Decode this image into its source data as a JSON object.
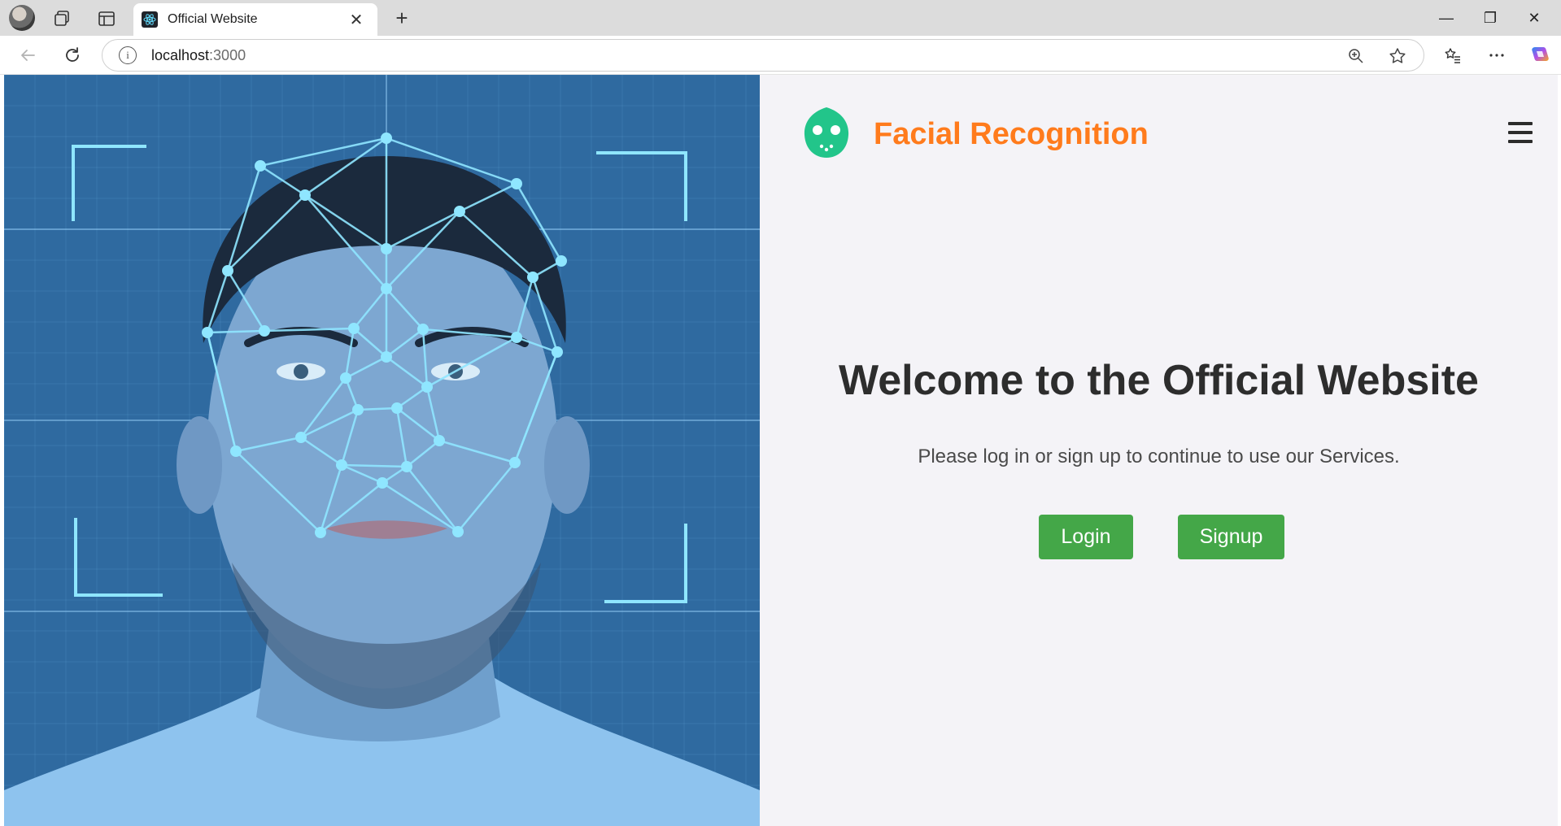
{
  "browser": {
    "tab_title": "Official Website",
    "tab_close": "✕",
    "new_tab": "+",
    "url_host": "localhost",
    "url_port": ":3000",
    "info_glyph": "i",
    "window_controls": {
      "minimize": "—",
      "restore": "❐",
      "close": "✕"
    },
    "icons": [
      "profile-avatar",
      "workspaces-icon",
      "tab-actions-icon",
      "react-favicon",
      "back-arrow-icon",
      "refresh-icon",
      "site-info-icon",
      "zoom-icon",
      "favorite-star-icon",
      "favorites-icon",
      "more-icon",
      "copilot-icon"
    ]
  },
  "header": {
    "brand": "Facial Recognition",
    "brand_color": "#ff7b1c",
    "logo_color": "#22c58a"
  },
  "main": {
    "welcome": "Welcome to the Official Website",
    "subtitle": "Please log in or sign up to continue to use our Services.",
    "login_label": "Login",
    "signup_label": "Signup",
    "button_color": "#44a748"
  },
  "hero": {
    "background_color": "#2f6aa0",
    "mesh_color": "#8fe6ff"
  }
}
